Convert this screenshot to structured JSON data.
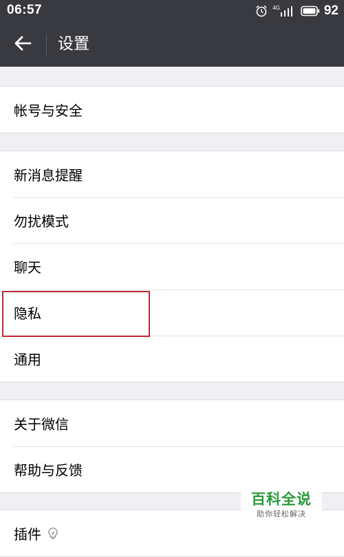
{
  "status_bar": {
    "time": "06:57",
    "alarm_icon": "alarm-clock-icon",
    "network_label": "4G",
    "signal_icon": "signal-bars-icon",
    "battery_icon": "battery-icon",
    "battery_level": "92"
  },
  "header": {
    "back_icon": "arrow-left-icon",
    "title": "设置"
  },
  "sections": [
    {
      "items": [
        "帐号与安全"
      ]
    },
    {
      "items": [
        "新消息提醒",
        "勿扰模式",
        "聊天",
        "隐私",
        "通用"
      ]
    },
    {
      "items": [
        "关于微信",
        "帮助与反馈"
      ]
    },
    {
      "items": [
        "插件"
      ]
    }
  ],
  "highlighted_item": "隐私",
  "colors": {
    "header_bg": "#393a3f",
    "page_bg": "#efeff4",
    "highlight": "#c0272d",
    "watermark_green": "#2a9a3c"
  },
  "watermark": {
    "title": "百科全说",
    "subtitle": "助你轻松解决"
  }
}
